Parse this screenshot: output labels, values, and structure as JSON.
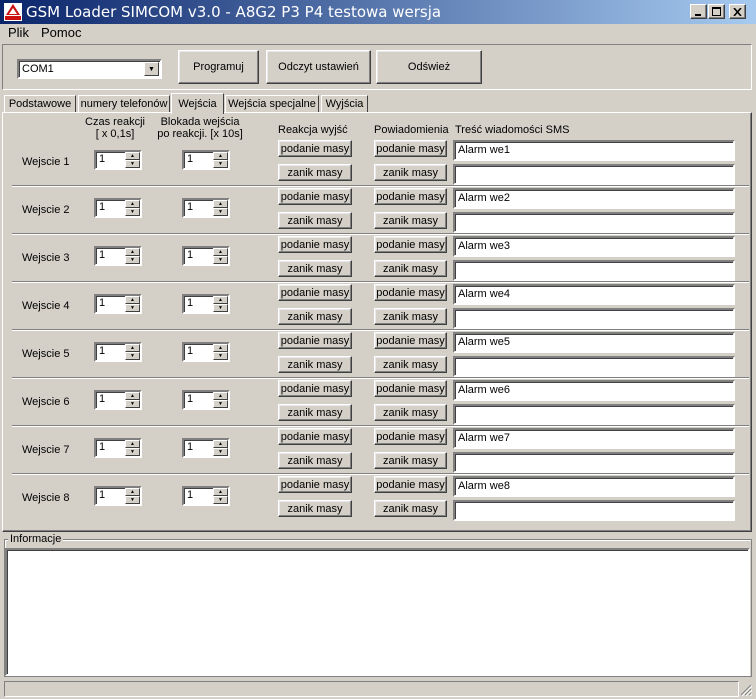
{
  "window": {
    "title": "GSM Loader SIMCOM v3.0 - A8G2 P3 P4 testowa wersja",
    "icon_label": "SATEL",
    "controls": [
      "minimize-icon",
      "maximize-icon",
      "close-icon"
    ]
  },
  "menu": {
    "items": [
      "Plik",
      "Pomoc"
    ]
  },
  "toolbar": {
    "port": "COM1",
    "program_label": "Programuj",
    "read_label": "Odczyt ustawień",
    "refresh_label": "Odśwież"
  },
  "tabs": [
    {
      "label": "Podstawowe",
      "active": false
    },
    {
      "label": "numery telefonów",
      "active": false
    },
    {
      "label": "Wejścia",
      "active": true
    },
    {
      "label": "Wejścia specjalne",
      "active": false
    },
    {
      "label": "Wyjścia",
      "active": false
    }
  ],
  "headers": {
    "reaction_time_1": "Czas reakcji",
    "reaction_time_2": "[ x 0,1s]",
    "lock_1": "Blokada wejścia",
    "lock_2": "po reakcji. [x 10s]",
    "outputs_reaction": "Reakcja wyjść",
    "notifications": "Powiadomienia",
    "sms_text": "Treść wiadomości SMS"
  },
  "inputs": [
    {
      "label": "Wejscie 1",
      "reaction_time": "1",
      "lock": "1",
      "sms": "Alarm we1"
    },
    {
      "label": "Wejscie 2",
      "reaction_time": "1",
      "lock": "1",
      "sms": "Alarm we2"
    },
    {
      "label": "Wejscie 3",
      "reaction_time": "1",
      "lock": "1",
      "sms": "Alarm we3"
    },
    {
      "label": "Wejscie 4",
      "reaction_time": "1",
      "lock": "1",
      "sms": "Alarm we4"
    },
    {
      "label": "Wejscie 5",
      "reaction_time": "1",
      "lock": "1",
      "sms": "Alarm we5"
    },
    {
      "label": "Wejscie 6",
      "reaction_time": "1",
      "lock": "1",
      "sms": "Alarm we6"
    },
    {
      "label": "Wejscie 7",
      "reaction_time": "1",
      "lock": "1",
      "sms": "Alarm we7"
    },
    {
      "label": "Wejscie 8",
      "reaction_time": "1",
      "lock": "1",
      "sms": "Alarm we8"
    }
  ],
  "buttons": {
    "mass_apply": "podanie masy",
    "mass_loss": "zanik masy"
  },
  "info": {
    "label": "Informacje",
    "content": ""
  }
}
